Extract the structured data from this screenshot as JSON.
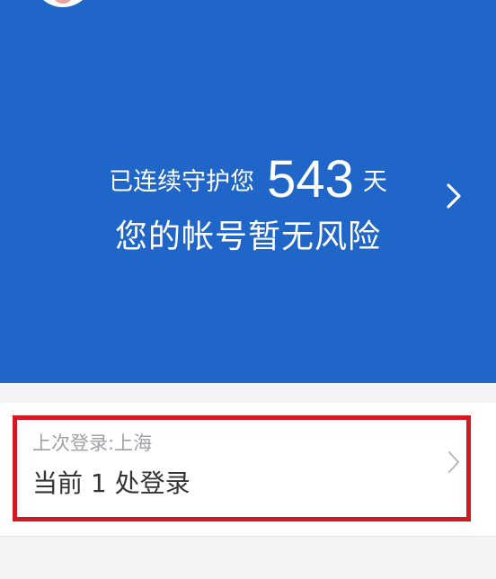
{
  "security_banner": {
    "guard_prefix": "已连续守护您",
    "guard_days": "543",
    "guard_unit": "天",
    "risk_status": "您的帐号暂无风险",
    "chevron_icon": "chevron-right-icon",
    "background_color": "#1f66c8"
  },
  "login_card": {
    "last_login": "上次登录:上海",
    "current_login": "当前 1 处登录",
    "chevron_icon": "chevron-right-icon",
    "highlight_color": "#d31a22"
  }
}
